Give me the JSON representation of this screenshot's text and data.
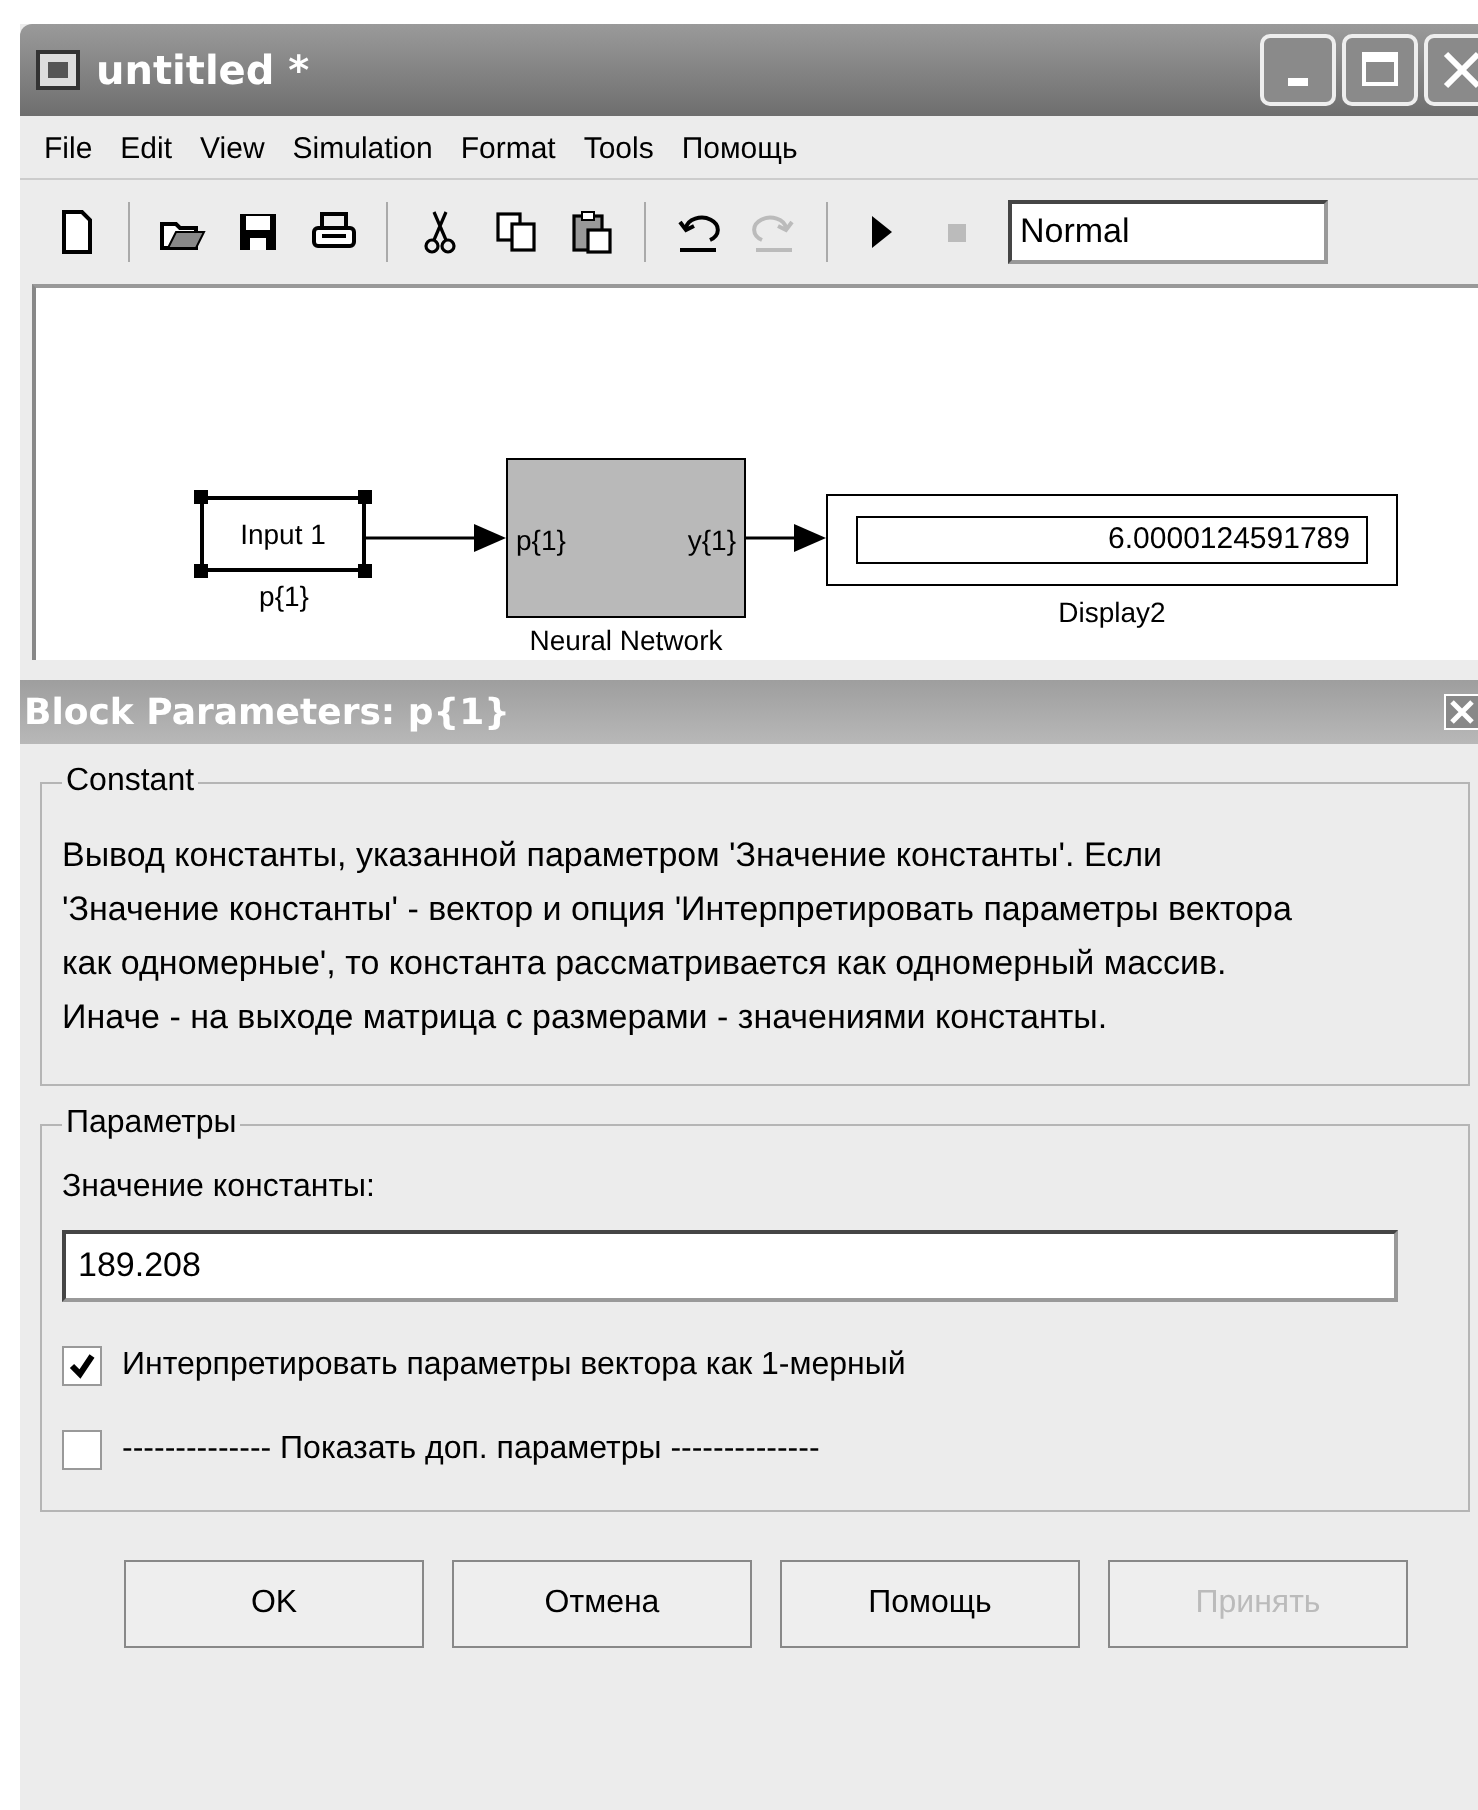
{
  "window": {
    "title": "untitled *"
  },
  "menu": [
    "File",
    "Edit",
    "View",
    "Simulation",
    "Format",
    "Tools",
    "Помощь"
  ],
  "toolbar": {
    "tools": [
      {
        "kind": "new",
        "disabled": false
      },
      {
        "kind": "sep"
      },
      {
        "kind": "open",
        "disabled": false
      },
      {
        "kind": "save",
        "disabled": false
      },
      {
        "kind": "print",
        "disabled": false
      },
      {
        "kind": "sep"
      },
      {
        "kind": "cut",
        "disabled": false
      },
      {
        "kind": "copy",
        "disabled": false
      },
      {
        "kind": "paste",
        "disabled": false
      },
      {
        "kind": "sep"
      },
      {
        "kind": "undo",
        "disabled": false
      },
      {
        "kind": "redo",
        "disabled": true
      },
      {
        "kind": "sep"
      },
      {
        "kind": "play",
        "disabled": false
      },
      {
        "kind": "stop",
        "disabled": true
      }
    ],
    "mode": "Normal"
  },
  "diagram": {
    "input": {
      "text": "Input 1",
      "label": "p{1}",
      "selected": true
    },
    "network": {
      "in_port": "p{1}",
      "out_port": "y{1}",
      "label": "Neural Network"
    },
    "display": {
      "value": "6.0000124591789",
      "label": "Display2"
    }
  },
  "dialog": {
    "title": "Block Parameters: p{1}",
    "description": {
      "legend": "Constant",
      "text": "Вывод константы, указанной параметром 'Значение константы'. Если 'Значение константы' - вектор и опция 'Интерпретировать параметры вектора как одномерные', то константа рассматривается как одномерный массив. Иначе - на выходе матрица с размерами - значениями константы."
    },
    "parameters": {
      "legend": "Параметры",
      "field_label": "Значение константы:",
      "value": "189.208",
      "options": [
        {
          "label": "Интерпретировать параметры вектора как 1-мерный",
          "checked": true
        },
        {
          "label": "-------------- Показать доп. параметры --------------",
          "checked": false
        }
      ]
    },
    "buttons": [
      {
        "label": "OK",
        "disabled": false
      },
      {
        "label": "Отмена",
        "disabled": false
      },
      {
        "label": "Помощь",
        "disabled": false
      },
      {
        "label": "Принять",
        "disabled": true
      }
    ]
  }
}
